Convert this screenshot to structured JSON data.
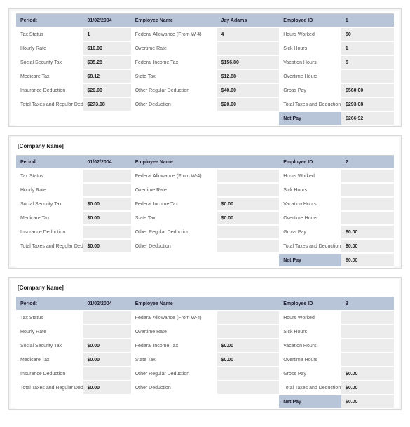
{
  "labels": {
    "company": "[Company Name]",
    "period": "Period:",
    "empName": "Employee Name",
    "empId": "Employee ID",
    "taxStatus": "Tax Status",
    "fedAllow": "Federal Allowance (From W-4)",
    "hoursWorked": "Hours Worked",
    "hourlyRate": "Hourly Rate",
    "overtimeRate": "Overtime Rate",
    "sickHours": "Sick Hours",
    "sst": "Social Security Tax",
    "fit": "Federal Income Tax",
    "vacHours": "Vacation Hours",
    "medTax": "Medicare Tax",
    "stateTax": "State Tax",
    "otHours": "Overtime Hours",
    "insDed": "Insurance Deduction",
    "otherReg": "Other Regular Deduction",
    "gross": "Gross Pay",
    "totalTax": "Total Taxes and Regular Deductions",
    "otherDed": "Other Deduction",
    "totalDed": "Total Taxes and Deductions",
    "netPay": "Net Pay"
  },
  "stubs": [
    {
      "showCompany": false,
      "period": "01/02/2004",
      "empName": "Jay Adams",
      "empId": "1",
      "taxStatus": "1",
      "fedAllow": "4",
      "hoursWorked": "50",
      "hourlyRate": "$10.00",
      "overtimeRate": "",
      "sickHours": "1",
      "sst": "$35.28",
      "fit": "$156.80",
      "vacHours": "5",
      "medTax": "$8.12",
      "stateTax": "$12.88",
      "otHours": "",
      "insDed": "$20.00",
      "otherReg": "$40.00",
      "gross": "$560.00",
      "totalTax": "$273.08",
      "otherDed": "$20.00",
      "totalDed": "$293.08",
      "netPay": "$266.92"
    },
    {
      "showCompany": true,
      "period": "01/02/2004",
      "empName": "",
      "empId": "2",
      "taxStatus": "",
      "fedAllow": "",
      "hoursWorked": "",
      "hourlyRate": "",
      "overtimeRate": "",
      "sickHours": "",
      "sst": "$0.00",
      "fit": "$0.00",
      "vacHours": "",
      "medTax": "$0.00",
      "stateTax": "$0.00",
      "otHours": "",
      "insDed": "",
      "otherReg": "",
      "gross": "$0.00",
      "totalTax": "$0.00",
      "otherDed": "",
      "totalDed": "$0.00",
      "netPay": "$0.00"
    },
    {
      "showCompany": true,
      "period": "01/02/2004",
      "empName": "",
      "empId": "3",
      "taxStatus": "",
      "fedAllow": "",
      "hoursWorked": "",
      "hourlyRate": "",
      "overtimeRate": "",
      "sickHours": "",
      "sst": "$0.00",
      "fit": "$0.00",
      "vacHours": "",
      "medTax": "$0.00",
      "stateTax": "$0.00",
      "otHours": "",
      "insDed": "",
      "otherReg": "",
      "gross": "$0.00",
      "totalTax": "$0.00",
      "otherDed": "",
      "totalDed": "$0.00",
      "netPay": "$0.00"
    }
  ]
}
